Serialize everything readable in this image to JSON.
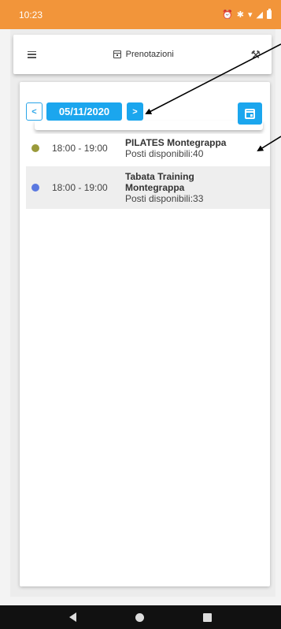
{
  "status_bar": {
    "time": "10:23",
    "icons": [
      "alarm-icon",
      "bluetooth-icon",
      "wifi-icon",
      "signal-icon",
      "battery-icon"
    ]
  },
  "header": {
    "menu_icon": "hamburger-menu-icon",
    "title_icon": "calendar-plus-icon",
    "title": "Prenotazioni",
    "right_icon": "tools-icon"
  },
  "date_nav": {
    "prev_label": "<",
    "date": "05/11/2020",
    "next_label": ">",
    "calendar_icon": "calendar-icon"
  },
  "activities": [
    {
      "dot_color": "#9a9a3a",
      "time": "18:00 - 19:00",
      "name": "PILATES Montegrappa",
      "name_line2": "",
      "availability": "Posti disponibili:40"
    },
    {
      "dot_color": "#5a78e0",
      "time": "18:00 - 19:00",
      "name": "Tabata Training",
      "name_line2": "Montegrappa",
      "availability": "Posti disponibili:33"
    }
  ],
  "colors": {
    "status_bar": "#f2953a",
    "accent": "#1ba6ee",
    "nav_bar": "#111111"
  },
  "nav_bar": {
    "icons": [
      "back-icon",
      "home-icon",
      "recents-icon"
    ]
  }
}
